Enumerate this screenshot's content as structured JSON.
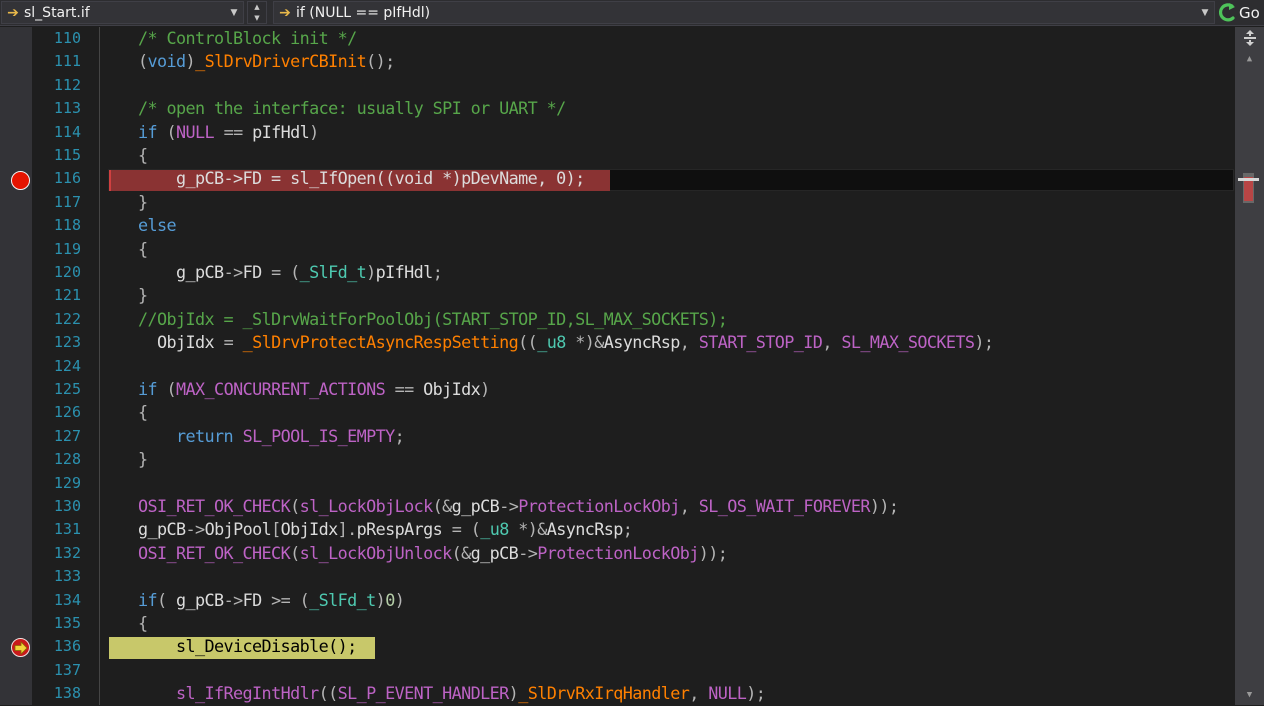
{
  "navbar": {
    "file_scope": "sl_Start.if",
    "member_scope": "if (NULL == pIfHdl)",
    "go_label": "Go"
  },
  "icons": {
    "scope_arrow": "arrow-right-icon",
    "dropdown": "chevron-down-icon",
    "go": "go-icon",
    "breakpoint": "breakpoint-icon",
    "current_statement_breakpoint": "breakpoint-current-statement-icon"
  },
  "colors": {
    "breakpoint_line": "#8a3333",
    "current_statement": "#c8c86a",
    "comment": "#57a64a",
    "keyword": "#569cd6",
    "macro": "#bd63c5",
    "static_function": "#ff8000",
    "line_number": "#2b91af"
  },
  "editor": {
    "lines": [
      {
        "number": "110",
        "tokens": [
          {
            "t": "    "
          },
          {
            "t": "/* ControlBlock init */",
            "c": "cm"
          }
        ]
      },
      {
        "number": "111",
        "tokens": [
          {
            "t": "    "
          },
          {
            "t": "(",
            "c": "op"
          },
          {
            "t": "void",
            "c": "kw"
          },
          {
            "t": ")",
            "c": "op"
          },
          {
            "t": "_SlDrvDriverCBInit",
            "c": "sfn"
          },
          {
            "t": "();",
            "c": "op"
          }
        ]
      },
      {
        "number": "112",
        "tokens": []
      },
      {
        "number": "113",
        "tokens": [
          {
            "t": "    "
          },
          {
            "t": "/* open the interface: usually SPI or UART */",
            "c": "cm"
          }
        ]
      },
      {
        "number": "114",
        "tokens": [
          {
            "t": "    "
          },
          {
            "t": "if",
            "c": "kw"
          },
          {
            "t": " (",
            "c": "op"
          },
          {
            "t": "NULL",
            "c": "mac"
          },
          {
            "t": " == ",
            "c": "op"
          },
          {
            "t": "pIfHdl",
            "c": "var"
          },
          {
            "t": ")",
            "c": "op"
          }
        ]
      },
      {
        "number": "115",
        "tokens": [
          {
            "t": "    "
          },
          {
            "t": "{",
            "c": "op"
          }
        ]
      },
      {
        "number": "116",
        "tokens": [
          {
            "t": "        g_pCB->FD = sl_IfOpen((void *)pDevName, 0);",
            "c": "var"
          }
        ]
      },
      {
        "number": "117",
        "tokens": [
          {
            "t": "    "
          },
          {
            "t": "}",
            "c": "op"
          }
        ]
      },
      {
        "number": "118",
        "tokens": [
          {
            "t": "    "
          },
          {
            "t": "else",
            "c": "kw"
          }
        ]
      },
      {
        "number": "119",
        "tokens": [
          {
            "t": "    "
          },
          {
            "t": "{",
            "c": "op"
          }
        ]
      },
      {
        "number": "120",
        "tokens": [
          {
            "t": "        "
          },
          {
            "t": "g_pCB",
            "c": "var"
          },
          {
            "t": "->",
            "c": "op"
          },
          {
            "t": "FD",
            "c": "mem"
          },
          {
            "t": " = (",
            "c": "op"
          },
          {
            "t": "_SlFd_t",
            "c": "type"
          },
          {
            "t": ")",
            "c": "op"
          },
          {
            "t": "pIfHdl",
            "c": "var"
          },
          {
            "t": ";",
            "c": "op"
          }
        ]
      },
      {
        "number": "121",
        "tokens": [
          {
            "t": "    "
          },
          {
            "t": "}",
            "c": "op"
          }
        ]
      },
      {
        "number": "122",
        "tokens": [
          {
            "t": "    "
          },
          {
            "t": "//ObjIdx = _SlDrvWaitForPoolObj(START_STOP_ID,SL_MAX_SOCKETS);",
            "c": "cm"
          }
        ]
      },
      {
        "number": "123",
        "tokens": [
          {
            "t": "      "
          },
          {
            "t": "ObjIdx",
            "c": "var"
          },
          {
            "t": " = ",
            "c": "op"
          },
          {
            "t": "_SlDrvProtectAsyncRespSetting",
            "c": "sfn"
          },
          {
            "t": "((",
            "c": "op"
          },
          {
            "t": "_u8",
            "c": "type"
          },
          {
            "t": " *)&",
            "c": "op"
          },
          {
            "t": "AsyncRsp",
            "c": "var"
          },
          {
            "t": ", ",
            "c": "op"
          },
          {
            "t": "START_STOP_ID",
            "c": "mac"
          },
          {
            "t": ", ",
            "c": "op"
          },
          {
            "t": "SL_MAX_SOCKETS",
            "c": "mac"
          },
          {
            "t": ");",
            "c": "op"
          }
        ]
      },
      {
        "number": "124",
        "tokens": []
      },
      {
        "number": "125",
        "tokens": [
          {
            "t": "    "
          },
          {
            "t": "if",
            "c": "kw"
          },
          {
            "t": " (",
            "c": "op"
          },
          {
            "t": "MAX_CONCURRENT_ACTIONS",
            "c": "mac"
          },
          {
            "t": " == ",
            "c": "op"
          },
          {
            "t": "ObjIdx",
            "c": "var"
          },
          {
            "t": ")",
            "c": "op"
          }
        ]
      },
      {
        "number": "126",
        "tokens": [
          {
            "t": "    "
          },
          {
            "t": "{",
            "c": "op"
          }
        ]
      },
      {
        "number": "127",
        "tokens": [
          {
            "t": "        "
          },
          {
            "t": "return",
            "c": "kw"
          },
          {
            "t": " "
          },
          {
            "t": "SL_POOL_IS_EMPTY",
            "c": "mac"
          },
          {
            "t": ";",
            "c": "op"
          }
        ]
      },
      {
        "number": "128",
        "tokens": [
          {
            "t": "    "
          },
          {
            "t": "}",
            "c": "op"
          }
        ]
      },
      {
        "number": "129",
        "tokens": []
      },
      {
        "number": "130",
        "tokens": [
          {
            "t": "    "
          },
          {
            "t": "OSI_RET_OK_CHECK",
            "c": "mac"
          },
          {
            "t": "(",
            "c": "op"
          },
          {
            "t": "sl_LockObjLock",
            "c": "mac"
          },
          {
            "t": "(&",
            "c": "op"
          },
          {
            "t": "g_pCB",
            "c": "var"
          },
          {
            "t": "->",
            "c": "op"
          },
          {
            "t": "ProtectionLockObj",
            "c": "mac"
          },
          {
            "t": ", ",
            "c": "op"
          },
          {
            "t": "SL_OS_WAIT_FOREVER",
            "c": "mac"
          },
          {
            "t": "));",
            "c": "op"
          }
        ]
      },
      {
        "number": "131",
        "tokens": [
          {
            "t": "    "
          },
          {
            "t": "g_pCB",
            "c": "var"
          },
          {
            "t": "->",
            "c": "op"
          },
          {
            "t": "ObjPool",
            "c": "mem"
          },
          {
            "t": "[",
            "c": "op"
          },
          {
            "t": "ObjIdx",
            "c": "var"
          },
          {
            "t": "].",
            "c": "op"
          },
          {
            "t": "pRespArgs",
            "c": "mem"
          },
          {
            "t": " = (",
            "c": "op"
          },
          {
            "t": "_u8",
            "c": "type"
          },
          {
            "t": " *)&",
            "c": "op"
          },
          {
            "t": "AsyncRsp",
            "c": "var"
          },
          {
            "t": ";",
            "c": "op"
          }
        ]
      },
      {
        "number": "132",
        "tokens": [
          {
            "t": "    "
          },
          {
            "t": "OSI_RET_OK_CHECK",
            "c": "mac"
          },
          {
            "t": "(",
            "c": "op"
          },
          {
            "t": "sl_LockObjUnlock",
            "c": "mac"
          },
          {
            "t": "(&",
            "c": "op"
          },
          {
            "t": "g_pCB",
            "c": "var"
          },
          {
            "t": "->",
            "c": "op"
          },
          {
            "t": "ProtectionLockObj",
            "c": "mac"
          },
          {
            "t": "));",
            "c": "op"
          }
        ]
      },
      {
        "number": "133",
        "tokens": []
      },
      {
        "number": "134",
        "tokens": [
          {
            "t": "    "
          },
          {
            "t": "if",
            "c": "kw"
          },
          {
            "t": "( ",
            "c": "op"
          },
          {
            "t": "g_pCB",
            "c": "var"
          },
          {
            "t": "->",
            "c": "op"
          },
          {
            "t": "FD",
            "c": "mem"
          },
          {
            "t": " >= (",
            "c": "op"
          },
          {
            "t": "_SlFd_t",
            "c": "type"
          },
          {
            "t": ")",
            "c": "op"
          },
          {
            "t": "0",
            "c": "num"
          },
          {
            "t": ")",
            "c": "op"
          }
        ]
      },
      {
        "number": "135",
        "tokens": [
          {
            "t": "    "
          },
          {
            "t": "{",
            "c": "op"
          }
        ]
      },
      {
        "number": "136",
        "tokens": [
          {
            "t": "        sl_DeviceDisable();",
            "c": "dark"
          }
        ]
      },
      {
        "number": "137",
        "tokens": []
      },
      {
        "number": "138",
        "tokens": [
          {
            "t": "        "
          },
          {
            "t": "sl_IfRegIntHdlr",
            "c": "mac"
          },
          {
            "t": "((",
            "c": "op"
          },
          {
            "t": "SL_P_EVENT_HANDLER",
            "c": "mac"
          },
          {
            "t": ")",
            "c": "op"
          },
          {
            "t": "_SlDrvRxIrqHandler",
            "c": "sfn"
          },
          {
            "t": ", ",
            "c": "op"
          },
          {
            "t": "NULL",
            "c": "mac"
          },
          {
            "t": ");",
            "c": "op"
          }
        ]
      }
    ]
  }
}
